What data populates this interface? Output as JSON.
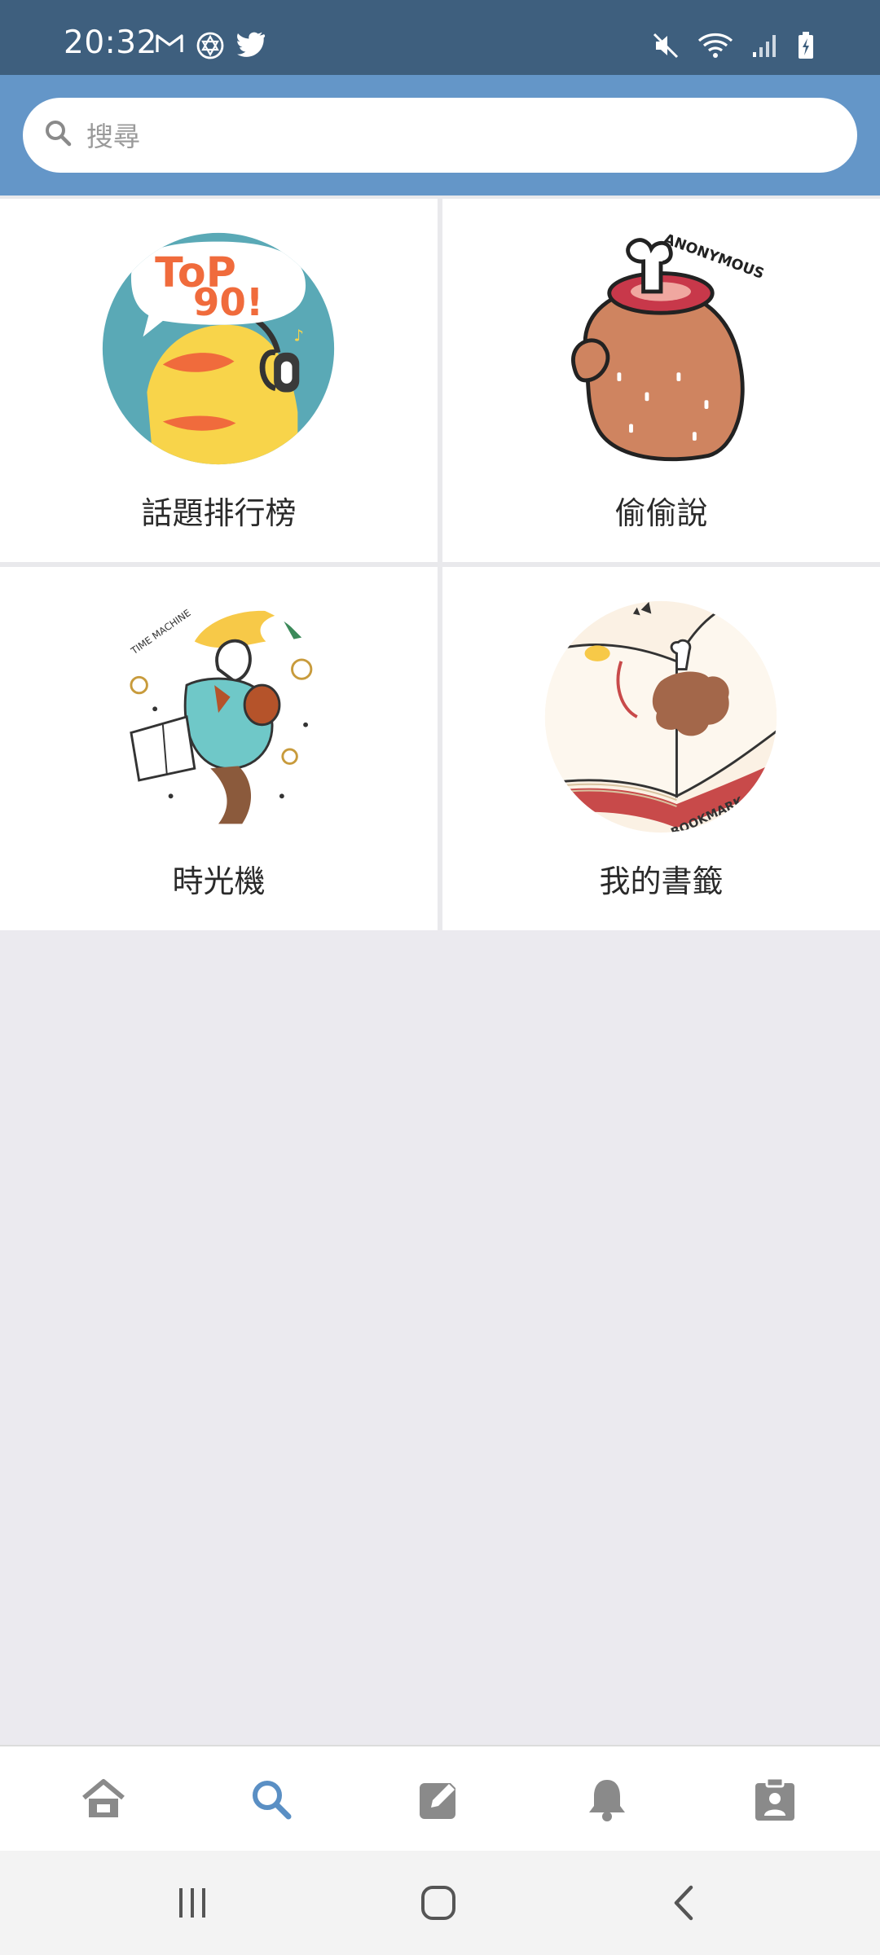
{
  "status_bar": {
    "time": "20:32",
    "left_icons": [
      "gmail-icon",
      "app-icon",
      "twitter-icon"
    ],
    "right_icons": [
      "mute-icon",
      "wifi-icon",
      "signal-icon",
      "battery-charging-icon"
    ]
  },
  "search": {
    "placeholder": "搜尋",
    "value": ""
  },
  "tiles": [
    {
      "label": "話題排行榜",
      "art_text": "Top 90!",
      "icon": "top90-duck-icon"
    },
    {
      "label": "偷偷說",
      "art_text": "ANONYMOUS",
      "icon": "anonymous-dog-icon"
    },
    {
      "label": "時光機",
      "art_text": "TIME MACHINE",
      "icon": "time-machine-icon"
    },
    {
      "label": "我的書籤",
      "art_text": "BOOKMARK",
      "icon": "bookmark-book-icon"
    }
  ],
  "tab_bar": {
    "active_index": 1,
    "tabs": [
      {
        "icon": "home-icon"
      },
      {
        "icon": "search-icon"
      },
      {
        "icon": "compose-icon"
      },
      {
        "icon": "bell-icon"
      },
      {
        "icon": "profile-icon"
      }
    ]
  },
  "system_nav": [
    "recent-apps-icon",
    "home-button-icon",
    "back-icon"
  ],
  "colors": {
    "status_bar": "#3e5f7e",
    "header": "#6496c8",
    "tab_active": "#5a8fc4",
    "tab_inactive": "#8a8a8a"
  }
}
